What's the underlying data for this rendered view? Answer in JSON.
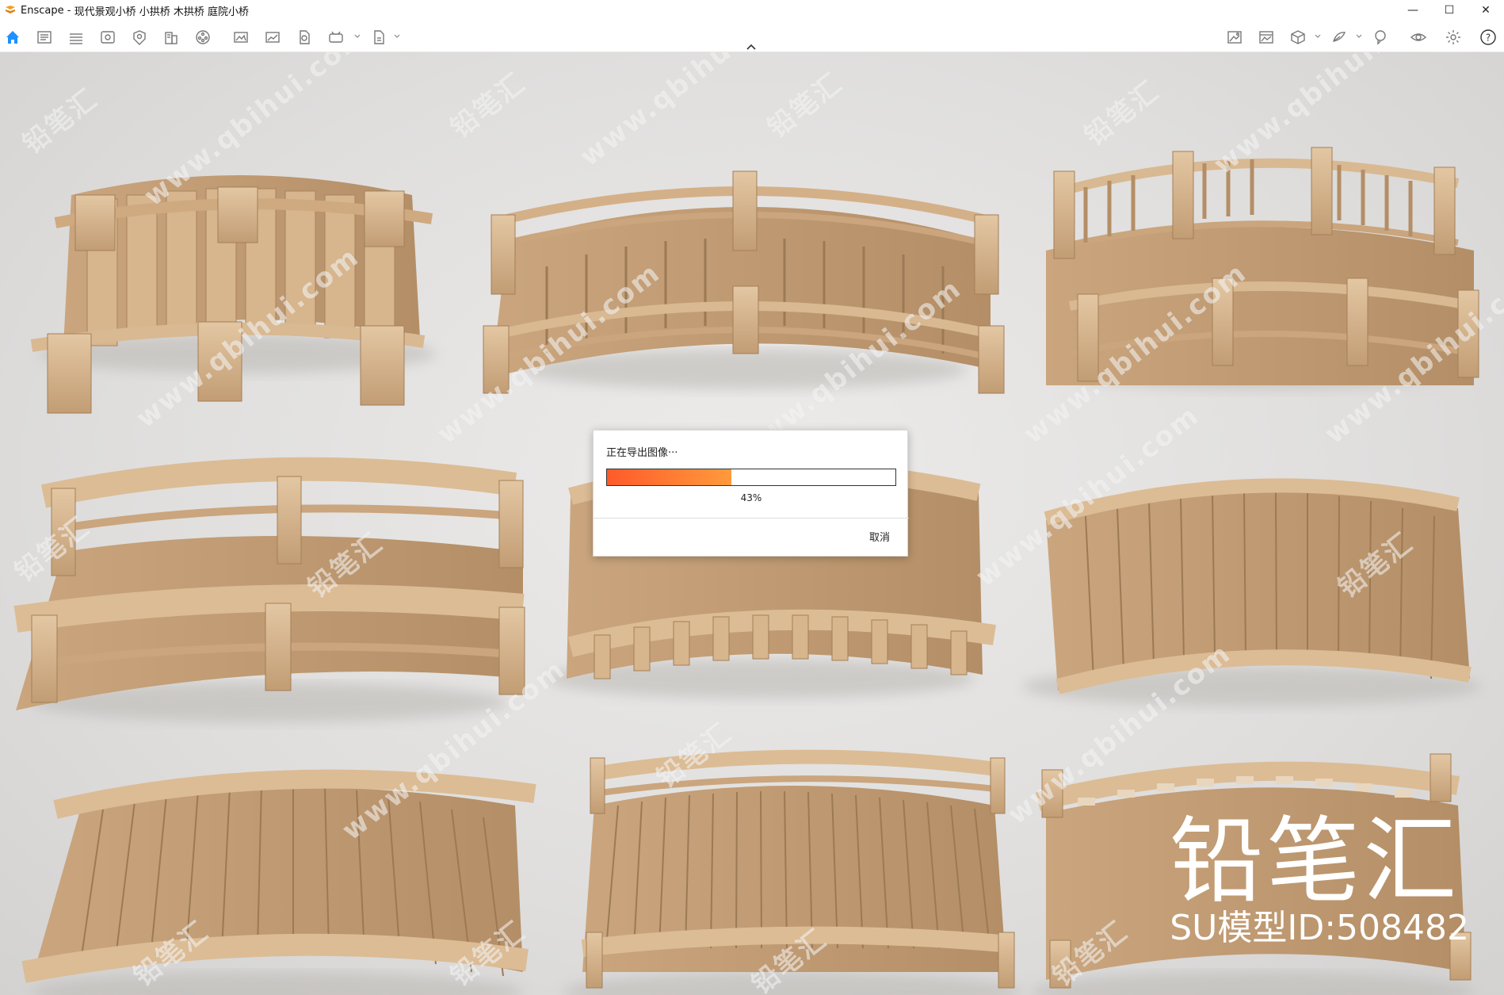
{
  "window": {
    "app_name": "Enscape",
    "separator": " - ",
    "document_title": "现代景观小桥 小拱桥 木拱桥 庭院小桥",
    "minimize_glyph": "—",
    "maximize_glyph": "☐",
    "close_glyph": "✕"
  },
  "toolbar": {
    "left_icons": [
      "home-icon",
      "views-icon",
      "bim-icon",
      "visual-settings-icon",
      "asset-library-icon",
      "building-icon",
      "video-editor-icon",
      "panorama-icon",
      "screenshot-icon",
      "batch-render-icon",
      "vr-export-icon",
      "export-icon"
    ],
    "right_icons": [
      "material-editor-icon",
      "image-icon",
      "cube-view-icon",
      "sketch-icon",
      "annotation-icon",
      "visibility-icon",
      "settings-icon",
      "help-icon"
    ],
    "help_glyph": "?"
  },
  "viewport": {
    "watermark_text": "铅笔汇",
    "watermark_site": "www.qbihui.com",
    "brand_name": "铅笔汇",
    "brand_model_id": "SU模型ID:508482"
  },
  "export_dialog": {
    "title": "正在导出图像···",
    "progress_percent": 43,
    "progress_label": "43%",
    "cancel_label": "取消"
  },
  "colors": {
    "progress_start": "#ff5a2a",
    "progress_end": "#ff9a3c",
    "home_icon": "#1e90ff",
    "wood_light": "#d9b992",
    "wood_mid": "#c7a27a",
    "wood_dark": "#9c7a55"
  }
}
